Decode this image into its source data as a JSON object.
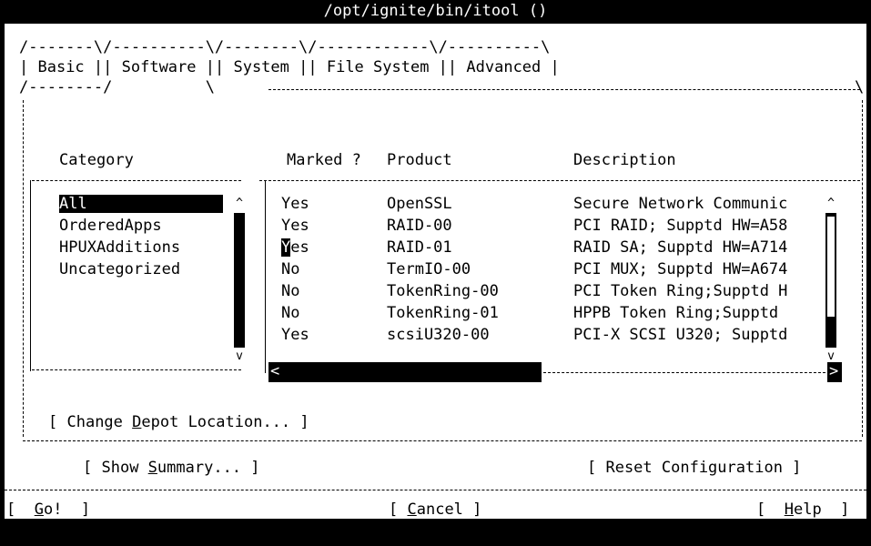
{
  "window": {
    "title": "/opt/ignite/bin/itool ()"
  },
  "tabs": [
    {
      "label": "Basic"
    },
    {
      "label": "Software"
    },
    {
      "label": "System"
    },
    {
      "label": "File System"
    },
    {
      "label": "Advanced"
    }
  ],
  "category": {
    "header": "Category",
    "items": [
      "All",
      "OrderedApps",
      "HPUXAdditions",
      "Uncategorized"
    ],
    "selected_index": 0
  },
  "products": {
    "headers": {
      "marked": "Marked ?",
      "product": "Product",
      "description": "Description"
    },
    "rows": [
      {
        "marked": "Yes",
        "product": "OpenSSL",
        "description": "Secure Network Communic"
      },
      {
        "marked": "Yes",
        "product": "RAID-00",
        "description": "PCI RAID; Supptd HW=A58"
      },
      {
        "marked": "Yes",
        "product": "RAID-01",
        "description": "RAID SA; Supptd HW=A714"
      },
      {
        "marked": "No",
        "product": "TermIO-00",
        "description": "PCI MUX; Supptd HW=A674"
      },
      {
        "marked": "No",
        "product": "TokenRing-00",
        "description": "PCI Token Ring;Supptd H"
      },
      {
        "marked": "No",
        "product": "TokenRing-01",
        "description": "HPPB Token Ring;Supptd "
      },
      {
        "marked": "Yes",
        "product": "scsiU320-00",
        "description": "PCI-X SCSI U320; Supptd"
      }
    ]
  },
  "buttons": {
    "change_depot": {
      "open": "[ ",
      "pre": "Change ",
      "key": "D",
      "post": "epot Location...",
      "close": " ]"
    },
    "show_summary": {
      "open": "[ ",
      "pre": "Show ",
      "key": "S",
      "post": "ummary...",
      "close": " ]"
    },
    "reset_config": "[ Reset Configuration ]",
    "go": {
      "open": "[  ",
      "key": "G",
      "post": "o!",
      "close": "  ]"
    },
    "cancel": {
      "open": "[ ",
      "key": "C",
      "post": "ancel",
      "close": " ]"
    },
    "help": {
      "open": "[  ",
      "key": "H",
      "post": "elp",
      "close": "  ]"
    }
  },
  "glyphs": {
    "up_arrow": "^",
    "down_arrow": "v",
    "left_arrow": "<",
    "right_arrow": ">"
  }
}
